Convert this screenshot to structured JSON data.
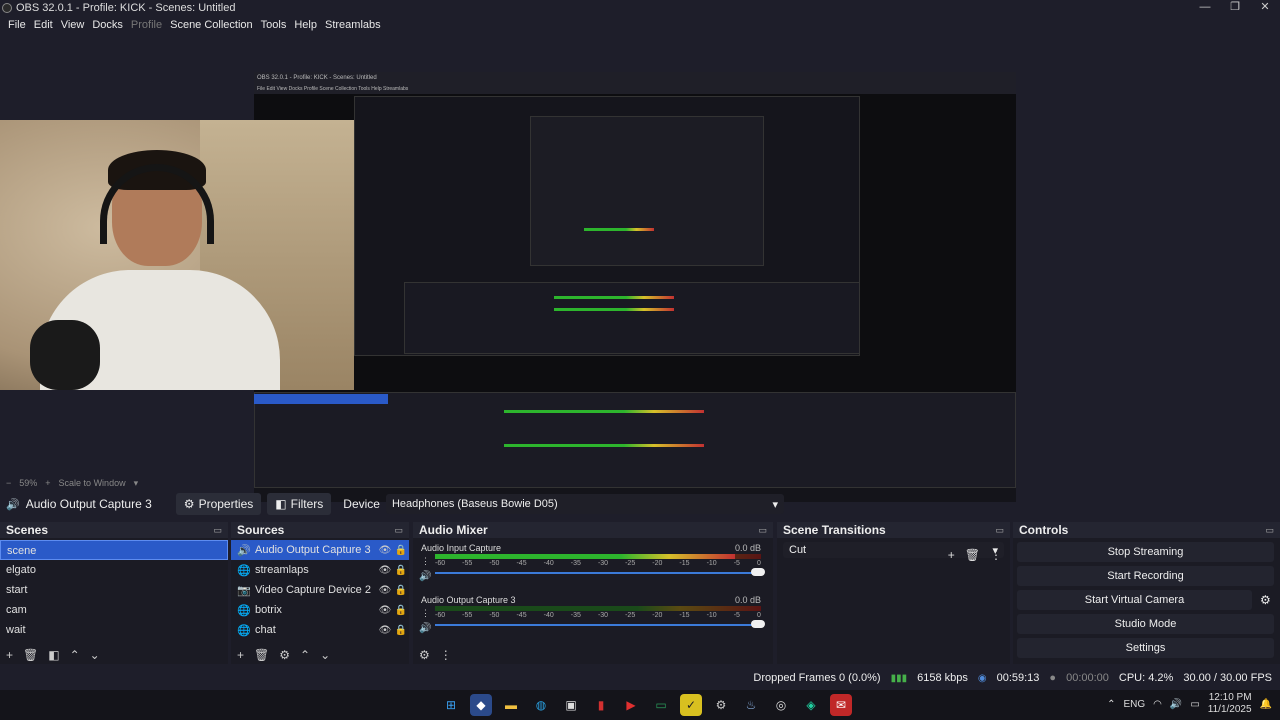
{
  "window": {
    "title": "OBS 32.0.1 - Profile: KICK - Scenes: Untitled",
    "controls": [
      "—",
      "❐",
      "✕"
    ]
  },
  "menu": [
    "File",
    "Edit",
    "View",
    "Docks",
    "Profile",
    "Scene Collection",
    "Tools",
    "Help",
    "Streamlabs"
  ],
  "nested_preview": {
    "title": "OBS 32.0.1 - Profile: KICK - Scenes: Untitled",
    "menu": "File  Edit  View  Docks  Profile  Scene Collection  Tools  Help  Streamlabs"
  },
  "zoom": {
    "level": "59%",
    "mode": "Scale to Window"
  },
  "source_toolbar": {
    "selected_source": "Audio Output Capture 3",
    "properties_label": "Properties",
    "filters_label": "Filters",
    "device_label": "Device",
    "device_value": "Headphones (Baseus Bowie D05)"
  },
  "scenes": {
    "title": "Scenes",
    "items": [
      "scene",
      "elgato",
      "start",
      "cam",
      "wait"
    ],
    "selected_index": 0
  },
  "sources": {
    "title": "Sources",
    "items": [
      {
        "label": "Audio Output Capture 3",
        "icon": "speaker-icon"
      },
      {
        "label": "streamlaps",
        "icon": "globe-icon"
      },
      {
        "label": "Video Capture Device 2",
        "icon": "camera-icon"
      },
      {
        "label": "botrix",
        "icon": "globe-icon"
      },
      {
        "label": "chat",
        "icon": "globe-icon"
      }
    ]
  },
  "audio_mixer": {
    "title": "Audio Mixer",
    "channels": [
      {
        "name": "Audio Input Capture",
        "db": "0.0 dB",
        "level": 0.92
      },
      {
        "name": "Audio Output Capture 3",
        "db": "0.0 dB",
        "level": 0.0
      }
    ],
    "ticks": [
      "-60",
      "-55",
      "-50",
      "-45",
      "-40",
      "-35",
      "-30",
      "-25",
      "-20",
      "-15",
      "-10",
      "-5",
      "0"
    ]
  },
  "scene_transitions": {
    "title": "Scene Transitions",
    "value": "Cut"
  },
  "controls": {
    "title": "Controls",
    "stop_streaming": "Stop Streaming",
    "start_recording": "Start Recording",
    "start_virtual_camera": "Start Virtual Camera",
    "studio_mode": "Studio Mode",
    "settings": "Settings"
  },
  "status": {
    "dropped_frames": "Dropped Frames 0 (0.0%)",
    "bitrate": "6158 kbps",
    "stream_time": "00:59:13",
    "rec_time": "00:00:00",
    "cpu": "CPU: 4.2%",
    "fps": "30.00 / 30.00 FPS"
  },
  "taskbar": {
    "lang": "ENG",
    "time": "12:10 PM",
    "date": "11/1/2025"
  },
  "colors": {
    "accent": "#2a5ac8",
    "meter_green": "#2db52d",
    "meter_yellow": "#d6c02a",
    "meter_red": "#c23131"
  }
}
